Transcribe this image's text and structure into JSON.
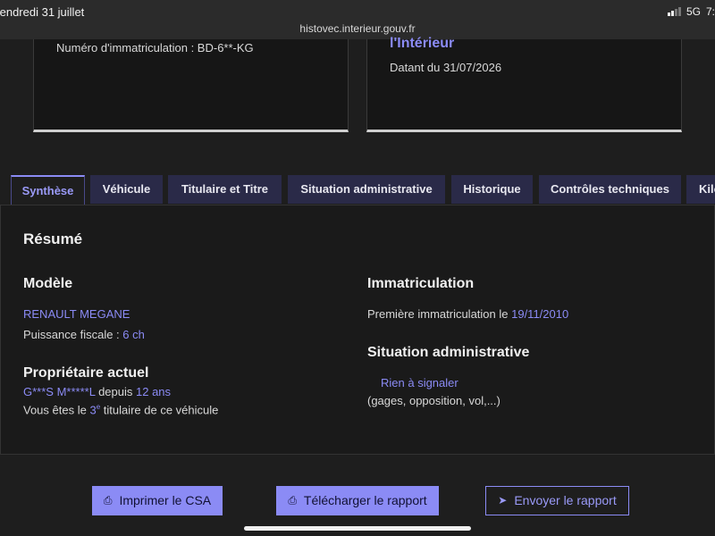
{
  "status": {
    "date": "/endredi 31 juillet",
    "network": "5G",
    "battery": "7:",
    "url": "histovec.interieur.gouv.fr"
  },
  "cards": {
    "left": {
      "plate_text": "Numéro d'immatriculation : BD-6**-KG"
    },
    "right": {
      "ministry": "l'Intérieur",
      "date_text": "Datant du 31/07/2026"
    }
  },
  "tabs": [
    "Synthèse",
    "Véhicule",
    "Titulaire et Titre",
    "Situation administrative",
    "Historique",
    "Contrôles techniques",
    "Kilo"
  ],
  "summary": {
    "title": "Résumé",
    "model": {
      "heading": "Modèle",
      "name": "RENAULT MEGANE",
      "power_label": "Puissance fiscale : ",
      "power_value": "6 ch"
    },
    "owner": {
      "heading": "Propriétaire actuel",
      "name": "G***S M*****L",
      "since_label": " depuis ",
      "since_value": "12 ans",
      "rank_prefix": "Vous êtes le ",
      "rank_num": "3",
      "rank_sup": "e",
      "rank_suffix": " titulaire de ce véhicule"
    },
    "registration": {
      "heading": "Immatriculation",
      "first_label": "Première immatriculation le ",
      "first_value": "19/11/2010"
    },
    "admin": {
      "heading": "Situation administrative",
      "status": "Rien à signaler",
      "details": "(gages, opposition, vol,...)"
    }
  },
  "actions": {
    "print": "Imprimer le CSA",
    "download": "Télécharger le rapport",
    "send": "Envoyer le rapport"
  }
}
